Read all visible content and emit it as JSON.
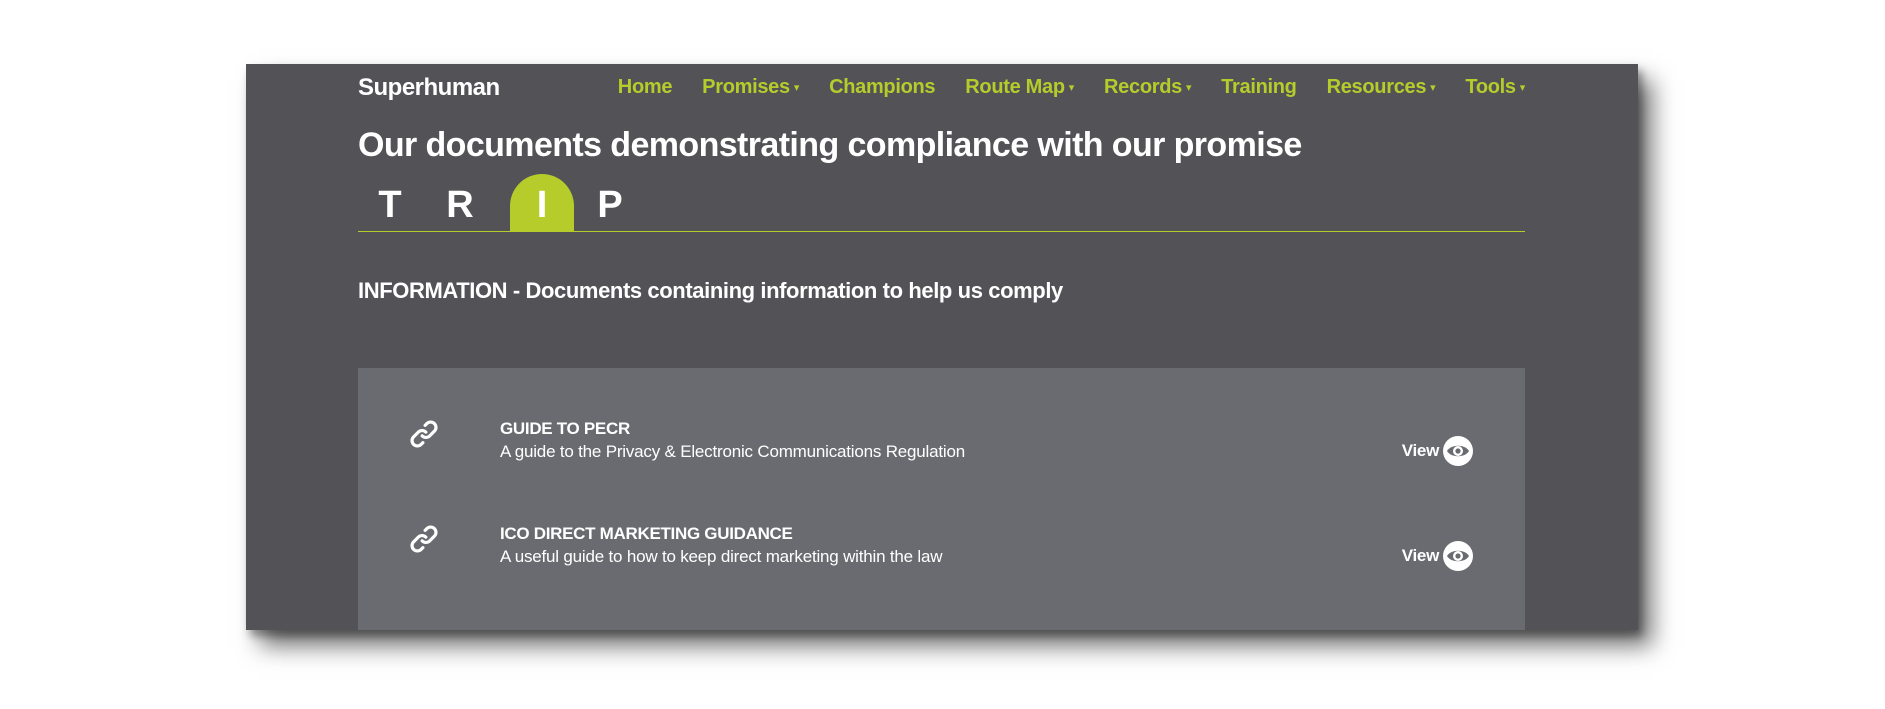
{
  "brand": "Superhuman",
  "nav": [
    {
      "label": "Home",
      "caret": ""
    },
    {
      "label": "Promises",
      "caret": "▾"
    },
    {
      "label": "Champions",
      "caret": ""
    },
    {
      "label": "Route Map",
      "caret": "▾"
    },
    {
      "label": "Records",
      "caret": "▾"
    },
    {
      "label": "Training",
      "caret": ""
    },
    {
      "label": "Resources",
      "caret": "▾"
    },
    {
      "label": "Tools",
      "caret": "▾"
    }
  ],
  "page_title": "Our documents demonstrating compliance with our promise",
  "tabs": [
    {
      "label": "T",
      "active": false
    },
    {
      "label": "R",
      "active": false
    },
    {
      "label": "I",
      "active": true
    },
    {
      "label": "P",
      "active": false
    }
  ],
  "section_heading": "INFORMATION - Documents containing information to help us comply",
  "documents": [
    {
      "title": "GUIDE TO PECR",
      "description": "A guide to the Privacy & Electronic Communications Regulation",
      "action": "View",
      "icon": "link-icon"
    },
    {
      "title": "ICO DIRECT MARKETING GUIDANCE",
      "description": "A useful guide to how to keep direct marketing within the law",
      "action": "View",
      "icon": "link-icon"
    }
  ],
  "colors": {
    "background": "#535357",
    "accent": "#b5cc2b",
    "panel": "#6a6b70",
    "text": "#ffffff"
  }
}
